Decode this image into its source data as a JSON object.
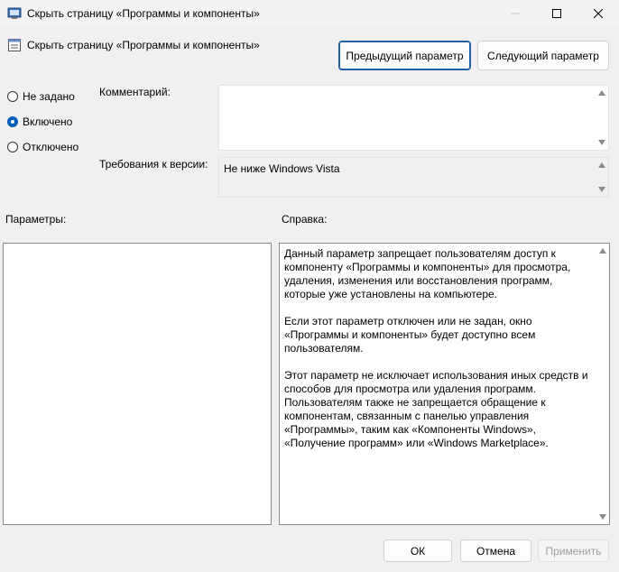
{
  "window": {
    "title": "Скрыть страницу «Программы и компоненты»"
  },
  "header": {
    "title": "Скрыть страницу «Программы и компоненты»",
    "prev_button": "Предыдущий параметр",
    "next_button": "Следующий параметр"
  },
  "state": {
    "options": [
      {
        "label": "Не задано",
        "checked": false
      },
      {
        "label": "Включено",
        "checked": true
      },
      {
        "label": "Отключено",
        "checked": false
      }
    ]
  },
  "comment": {
    "label": "Комментарий:",
    "value": ""
  },
  "requirements": {
    "label": "Требования к версии:",
    "value": "Не ниже Windows Vista"
  },
  "parameters": {
    "label": "Параметры:"
  },
  "help": {
    "label": "Справка:",
    "paragraphs": [
      "Данный параметр запрещает пользователям доступ к компоненту «Программы и компоненты» для просмотра, удаления, изменения или восстановления программ, которые уже установлены на компьютере.",
      "Если этот параметр отключен или не задан, окно «Программы и компоненты» будет доступно всем пользователям.",
      "Этот параметр не исключает использования иных средств и способов для просмотра или удаления программ. Пользователям также не запрещается обращение к компонентам, связанным с панелью управления «Программы», таким как «Компоненты Windows», «Получение программ» или «Windows Marketplace»."
    ]
  },
  "footer": {
    "ok": "ОК",
    "cancel": "Отмена",
    "apply": "Применить"
  },
  "colors": {
    "accent": "#005fb8",
    "window_bg": "#f0f0f0"
  }
}
